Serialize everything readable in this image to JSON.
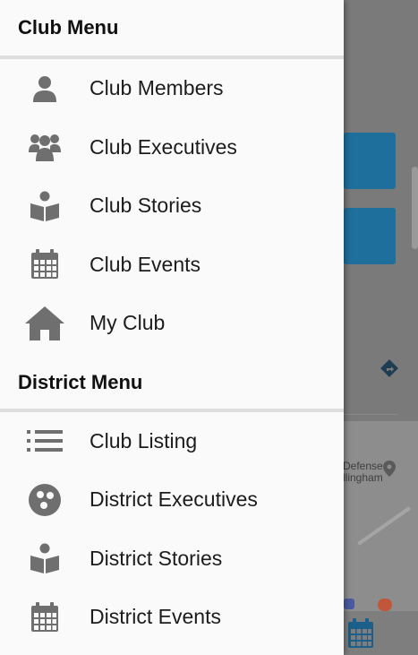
{
  "drawer": {
    "club_menu_title": "Club Menu",
    "club_items": [
      {
        "label": "Club Members",
        "icon": "person-icon"
      },
      {
        "label": "Club Executives",
        "icon": "group-icon"
      },
      {
        "label": "Club Stories",
        "icon": "book-reader-icon"
      },
      {
        "label": "Club Events",
        "icon": "calendar-icon"
      },
      {
        "label": "My Club",
        "icon": "home-icon"
      }
    ],
    "district_menu_title": "District Menu",
    "district_items": [
      {
        "label": "Club Listing",
        "icon": "list-icon"
      },
      {
        "label": "District Executives",
        "icon": "circle-dots-icon"
      },
      {
        "label": "District Stories",
        "icon": "book-reader-icon"
      },
      {
        "label": "District Events",
        "icon": "calendar-icon"
      }
    ]
  },
  "background": {
    "map_text": "Defense\nllingham"
  },
  "colors": {
    "icon_gray": "#6f6f6f",
    "background_accent": "#1e6f9c",
    "drawer_bg": "#fafafa"
  }
}
